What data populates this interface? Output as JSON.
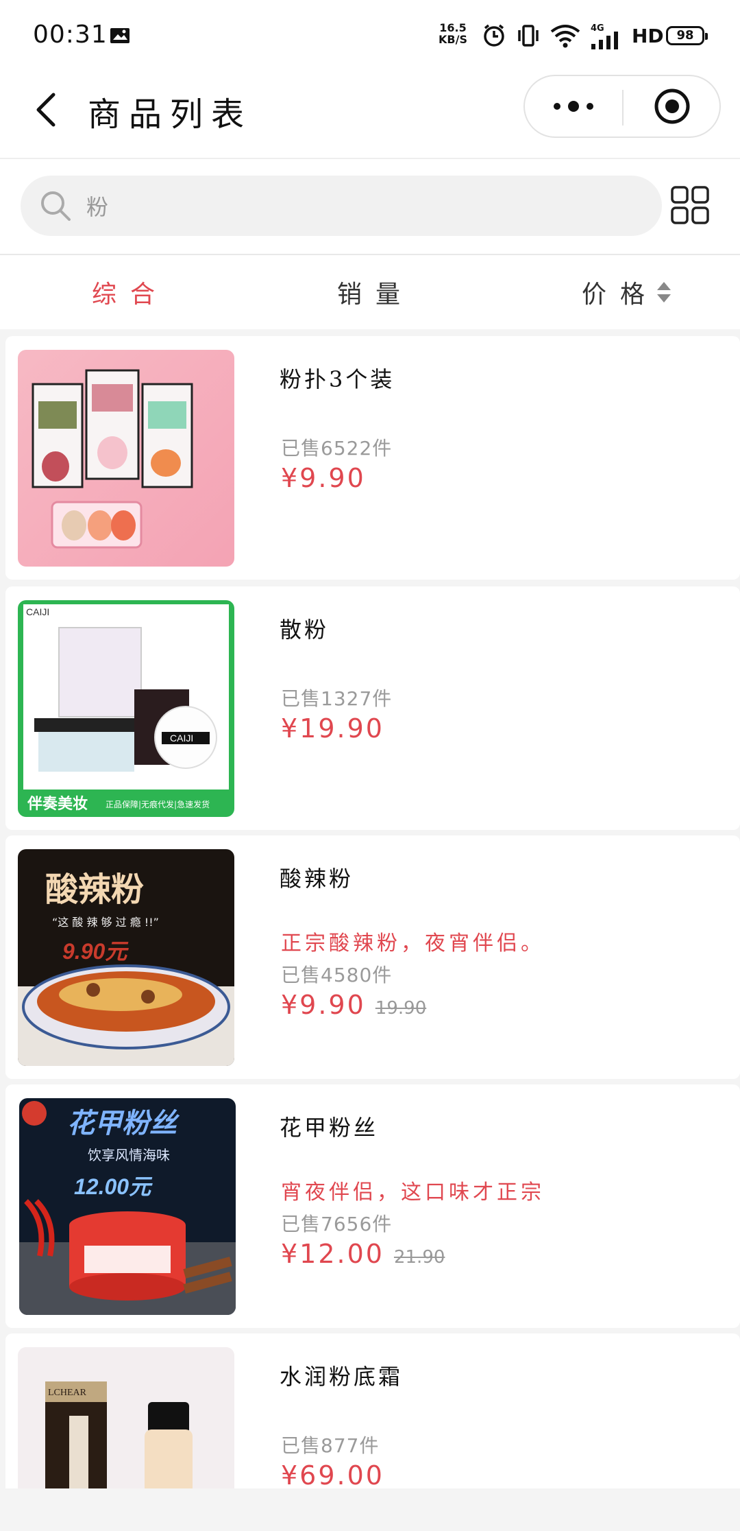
{
  "status_bar": {
    "time": "00:31",
    "net_speed_value": "16.5",
    "net_speed_unit": "KB/S",
    "network": "4G",
    "hd": "HD",
    "battery": "98"
  },
  "navbar": {
    "title": "商品列表"
  },
  "search": {
    "value": "粉"
  },
  "sort_tabs": [
    {
      "label": "综合",
      "active": true
    },
    {
      "label": "销量",
      "active": false
    },
    {
      "label": "价格",
      "active": false
    }
  ],
  "products": [
    {
      "name": "粉扑3个装",
      "desc": "",
      "sold": "已售6522件",
      "price": "¥9.90",
      "original_price": ""
    },
    {
      "name": "散粉",
      "desc": "",
      "sold": "已售1327件",
      "price": "¥19.90",
      "original_price": "",
      "image_text": {
        "brand": "CAIJI",
        "banner": "伴奏美妆",
        "tags": "正品保障|无痕代发|急速发货"
      }
    },
    {
      "name": "酸辣粉",
      "desc": "正宗酸辣粉，夜宵伴侣。",
      "sold": "已售4580件",
      "price": "¥9.90",
      "original_price": "19.90",
      "image_text": {
        "title": "酸辣粉",
        "slogan": "“这 酸 辣 够 过 瘾 !!”",
        "price": "9.90元"
      }
    },
    {
      "name": "花甲粉丝",
      "desc": "宵夜伴侣，这口味才正宗",
      "sold": "已售7656件",
      "price": "¥12.00",
      "original_price": "21.90",
      "image_text": {
        "title": "花甲粉丝",
        "slogan": "饮享风情海味",
        "price": "12.00元"
      }
    },
    {
      "name": "水润粉底霜",
      "desc": "",
      "sold": "已售877件",
      "price": "¥69.00",
      "original_price": "",
      "image_text": {
        "brand": "LCHEAR"
      }
    }
  ],
  "colors": {
    "accent": "#e0474f",
    "muted": "#9a9a9a"
  }
}
